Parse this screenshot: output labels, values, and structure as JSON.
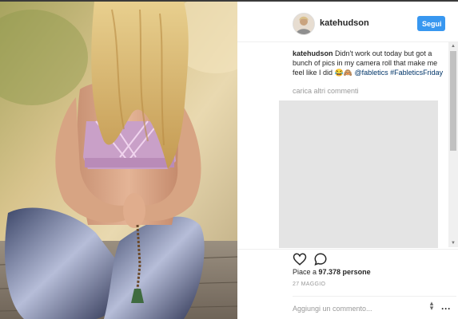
{
  "post": {
    "username": "katehudson",
    "follow_label": "Segui",
    "caption": {
      "username": "katehudson",
      "text": "Didn't work out today but got a bunch of pics in my camera roll that make me feel like I did 😂🙈 ",
      "mention": "@fabletics",
      "hashtag": "#FableticsFriday"
    },
    "load_more": "carica altri commenti",
    "likes_prefix": "Piace a ",
    "likes_count": "97.378 persone",
    "date": "27 MAGGIO",
    "comment_placeholder": "Aggiungi un commento...",
    "ellipsis": "···"
  },
  "icons": {
    "like": "heart-icon",
    "comment": "comment-bubble-icon",
    "scroll_up": "scroll-up-arrow-icon",
    "scroll_down": "scroll-down-arrow-icon",
    "input_spinner": "spinner-arrows-icon"
  },
  "colors": {
    "follow_button": "#3897f0",
    "link": "#003569",
    "muted_text": "#999999",
    "placeholder_box": "#e4e4e4"
  }
}
